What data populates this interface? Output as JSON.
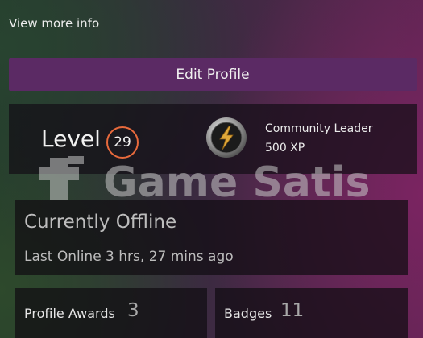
{
  "links": {
    "view_more": "View more info"
  },
  "actions": {
    "edit_profile": "Edit Profile"
  },
  "level": {
    "label": "Level",
    "value": "29",
    "ring_color": "#e86a3c"
  },
  "featured_badge": {
    "icon": "lightning-bolt-icon",
    "name": "Community Leader",
    "xp": "500 XP"
  },
  "watermark": {
    "text": "Game Satis"
  },
  "status": {
    "title": "Currently Offline",
    "last_online": "Last Online 3 hrs, 27 mins ago"
  },
  "tiles": {
    "profile_awards": {
      "label": "Profile Awards",
      "count": "3"
    },
    "badges": {
      "label": "Badges",
      "count": "11"
    }
  },
  "colors": {
    "accent_purple": "#5b2a64",
    "panel_dark": "#140e16",
    "badge_gold": "#e0a93a"
  }
}
